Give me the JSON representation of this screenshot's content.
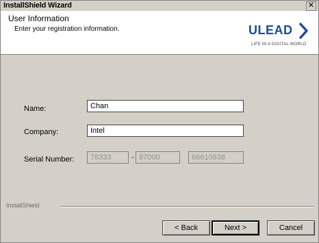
{
  "window": {
    "title": "InstallShield Wizard",
    "close_glyph": "✕"
  },
  "header": {
    "title": "User Information",
    "subtitle": "Enter your registration information.",
    "logo_text": "ULEAD",
    "logo_tagline": "LIFE IN A DIGITAL WORLD",
    "logo_color": "#1e4a9a"
  },
  "form": {
    "name_label": "Name:",
    "name_value": "Chan",
    "company_label": "Company:",
    "company_value": "Intel",
    "serial_label": "Serial Number:",
    "serial_part1": "78333",
    "serial_separator": "-",
    "serial_part2": "87000",
    "serial_part3": "66610838"
  },
  "footer": {
    "brand": "InstallShield"
  },
  "buttons": {
    "back": "< Back",
    "next": "Next >",
    "cancel": "Cancel"
  }
}
